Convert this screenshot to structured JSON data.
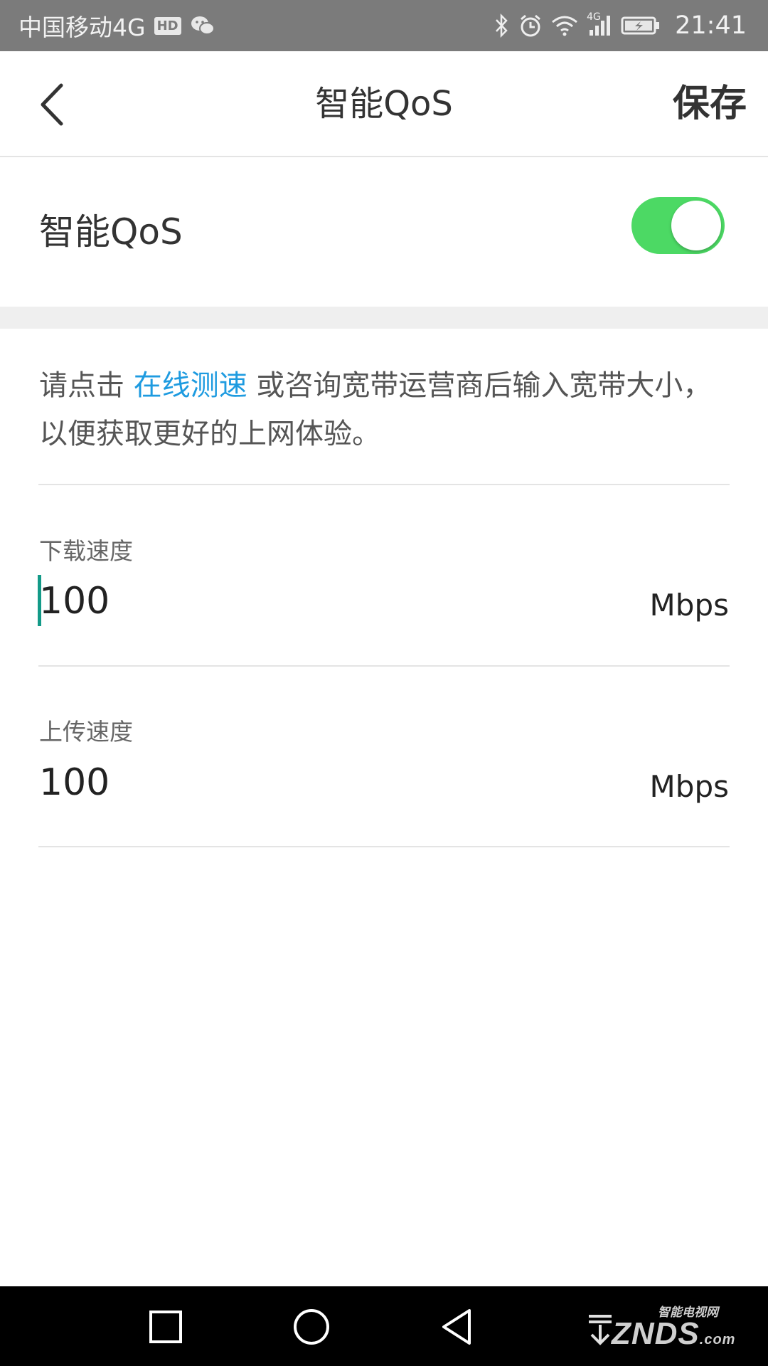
{
  "status_bar": {
    "carrier": "中国移动4G",
    "hd_badge": "HD",
    "time": "21:41",
    "network_badge": "4G",
    "icons": [
      "wechat-icon",
      "bluetooth-icon",
      "alarm-icon",
      "wifi-icon",
      "signal-icon",
      "battery-charging-icon"
    ]
  },
  "header": {
    "title": "智能QoS",
    "save_label": "保存"
  },
  "qos": {
    "label": "智能QoS",
    "enabled": true,
    "toggle_color": "#4cd964"
  },
  "hint": {
    "before": "请点击 ",
    "link": "在线测速",
    "after": " 或咨询宽带运营商后输入宽带大小，以便获取更好的上网体验。",
    "link_color": "#1e9be0"
  },
  "download": {
    "label": "下载速度",
    "value": "100",
    "unit": "Mbps"
  },
  "upload": {
    "label": "上传速度",
    "value": "100",
    "unit": "Mbps"
  },
  "nav_bar": {
    "icons": [
      "recent-apps-icon",
      "home-icon",
      "back-nav-icon",
      "download-arrow-icon"
    ]
  },
  "watermark": {
    "small": "智能电视网",
    "big": "ZNDS",
    "suffix": ".com"
  }
}
